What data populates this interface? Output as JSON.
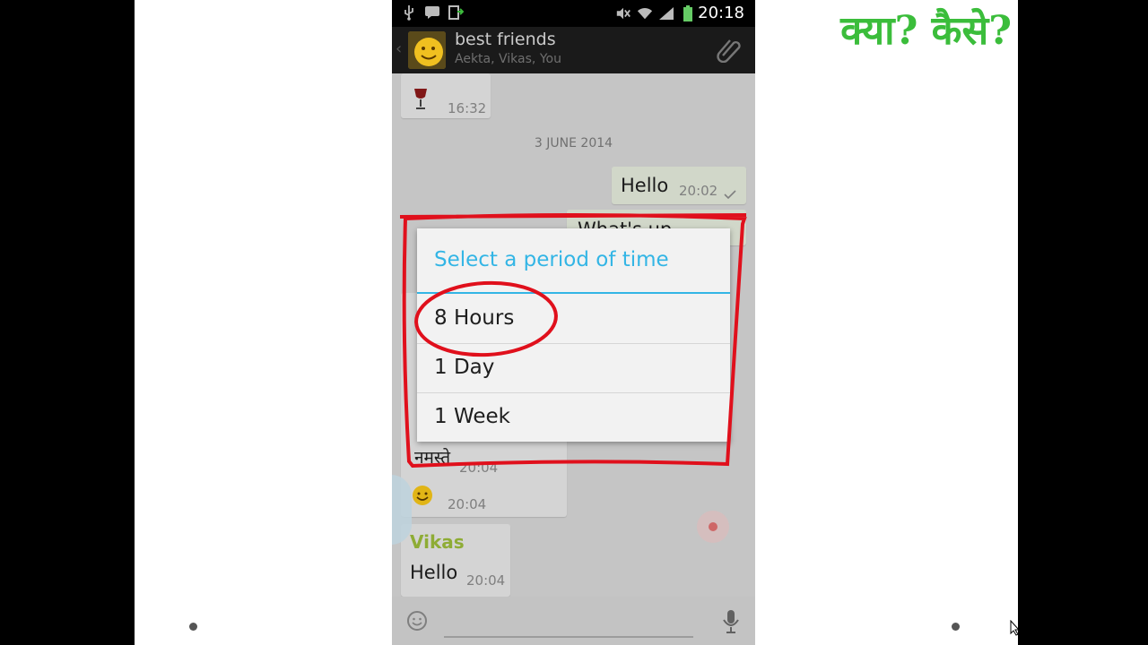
{
  "statusbar": {
    "time": "20:18"
  },
  "header": {
    "title": "best friends",
    "subtitle": "Aekta, Vikas, You"
  },
  "chat": {
    "msg1_time": "16:32",
    "date_separator": "3 JUNE 2014",
    "msg2_text": "Hello",
    "msg2_time": "20:02",
    "msg3_partial": "What's up",
    "msg4_text": "नमस्ते",
    "msg4_time": "20:04",
    "msg5_time": "20:04",
    "msg6_sender": "Vikas",
    "msg6_text": "Hello",
    "msg6_time": "20:04"
  },
  "dialog": {
    "title": "Select a period of time",
    "options": [
      {
        "label": "8 Hours"
      },
      {
        "label": "1 Day"
      },
      {
        "label": "1 Week"
      }
    ]
  },
  "overlay_text": {
    "hindi_caption": "क्या? कैसे?"
  },
  "colors": {
    "accent": "#33b5e5",
    "annotation": "#e0101c",
    "caption_green": "#3bbd3b",
    "sender_name": "#9bbb3a"
  }
}
